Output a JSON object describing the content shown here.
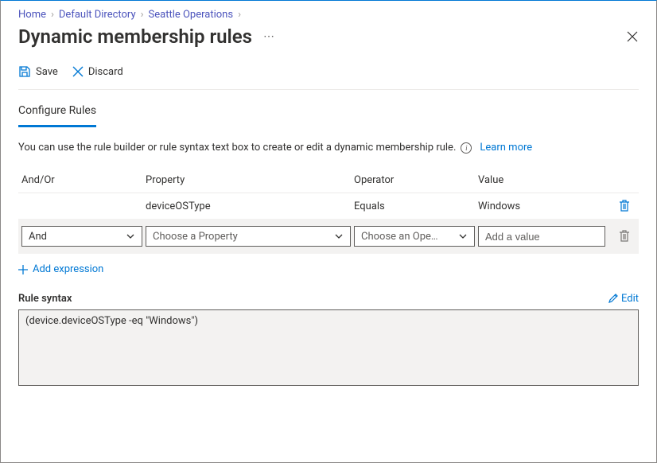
{
  "breadcrumb": {
    "items": [
      "Home",
      "Default Directory",
      "Seattle Operations"
    ]
  },
  "page": {
    "title": "Dynamic membership rules"
  },
  "toolbar": {
    "save_label": "Save",
    "discard_label": "Discard"
  },
  "section": {
    "configure_title": "Configure Rules",
    "help_text": "You can use the rule builder or rule syntax text box to create or edit a dynamic membership rule.",
    "learn_more": "Learn more"
  },
  "rule_table": {
    "headers": {
      "andor": "And/Or",
      "property": "Property",
      "operator": "Operator",
      "value": "Value"
    },
    "rows": [
      {
        "andor": "",
        "property": "deviceOSType",
        "operator": "Equals",
        "value": "Windows",
        "editing": false
      },
      {
        "andor": "And",
        "property_placeholder": "Choose a Property",
        "operator_placeholder": "Choose an Ope…",
        "value_placeholder": "Add a value",
        "editing": true
      }
    ],
    "add_expression": "Add expression"
  },
  "syntax": {
    "label": "Rule syntax",
    "edit": "Edit",
    "text": "(device.deviceOSType -eq \"Windows\")"
  }
}
